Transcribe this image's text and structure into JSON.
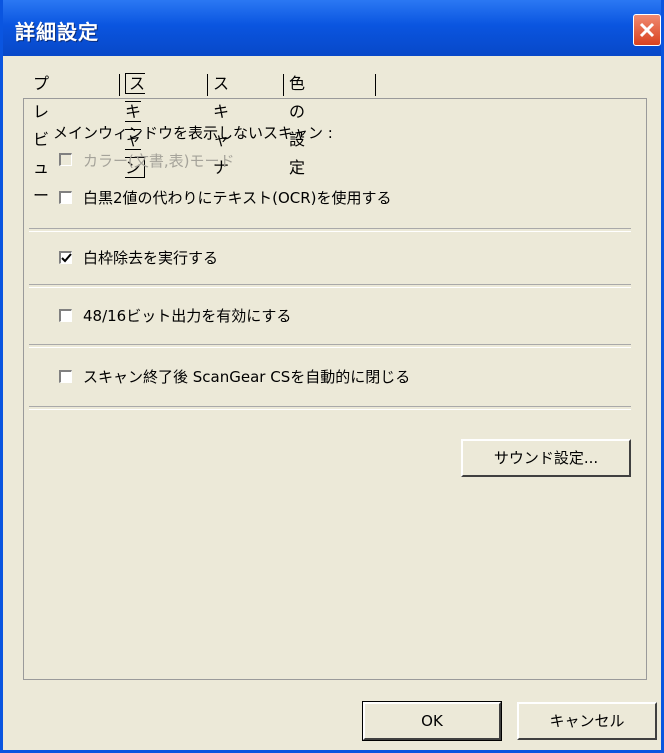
{
  "window": {
    "title": "詳細設定"
  },
  "tabs": [
    {
      "label": "プレビュー",
      "active": false
    },
    {
      "label": "スキャン",
      "active": true
    },
    {
      "label": "スキャナ",
      "active": false
    },
    {
      "label": "色の設定",
      "active": false
    }
  ],
  "scan": {
    "group_label": "メインウィンドウを表示しないスキャン :",
    "options": [
      {
        "label": "カラー(文書,表)モード",
        "checked": false,
        "disabled": true
      },
      {
        "label": "白黒2値の代わりにテキスト(OCR)を使用する",
        "checked": false,
        "disabled": false
      },
      {
        "label": "白枠除去を実行する",
        "checked": true,
        "disabled": false
      },
      {
        "label": "48/16ビット出力を有効にする",
        "checked": false,
        "disabled": false
      },
      {
        "label": "スキャン終了後 ScanGear CSを自動的に閉じる",
        "checked": false,
        "disabled": false
      }
    ],
    "sound_button": "サウンド設定..."
  },
  "footer": {
    "ok": "OK",
    "cancel": "キャンセル"
  }
}
